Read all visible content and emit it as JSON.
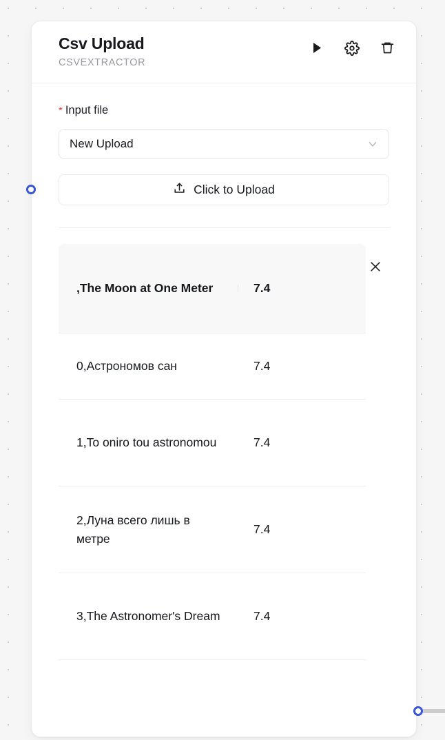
{
  "node": {
    "title": "Csv Upload",
    "subtitle": "CSVEXTRACTOR",
    "actions": [
      {
        "name": "run-button",
        "icon": "play-icon"
      },
      {
        "name": "settings-button",
        "icon": "gear-icon"
      },
      {
        "name": "delete-button",
        "icon": "trash-icon"
      }
    ]
  },
  "form": {
    "required_marker": "*",
    "input_file_label": "Input file",
    "source_select": {
      "value": "New Upload",
      "icon": "chevron-down-icon"
    },
    "upload_button": {
      "label": "Click to Upload",
      "icon": "upload-icon"
    }
  },
  "result": {
    "close_icon": "close-icon",
    "rows": [
      {
        "name": ",The Moon at One Meter",
        "value": "7.4",
        "is_header": true
      },
      {
        "name": "0,Астрономов сан",
        "value": "7.4",
        "is_header": false
      },
      {
        "name": "1,To oniro tou astronomou",
        "value": "7.4",
        "is_header": false
      },
      {
        "name": "2,Луна всего лишь в метре",
        "value": "7.4",
        "is_header": false
      },
      {
        "name": "3,The Astronomer's Dream",
        "value": "7.4",
        "is_header": false
      }
    ]
  },
  "handles": {
    "left": "input-handle",
    "right": "output-handle"
  },
  "colors": {
    "handle": "#3b55d9",
    "required": "#ef4444",
    "card_bg": "#ffffff",
    "canvas_bg": "#f6f6f6",
    "header_row_bg": "#f8f8f8"
  }
}
